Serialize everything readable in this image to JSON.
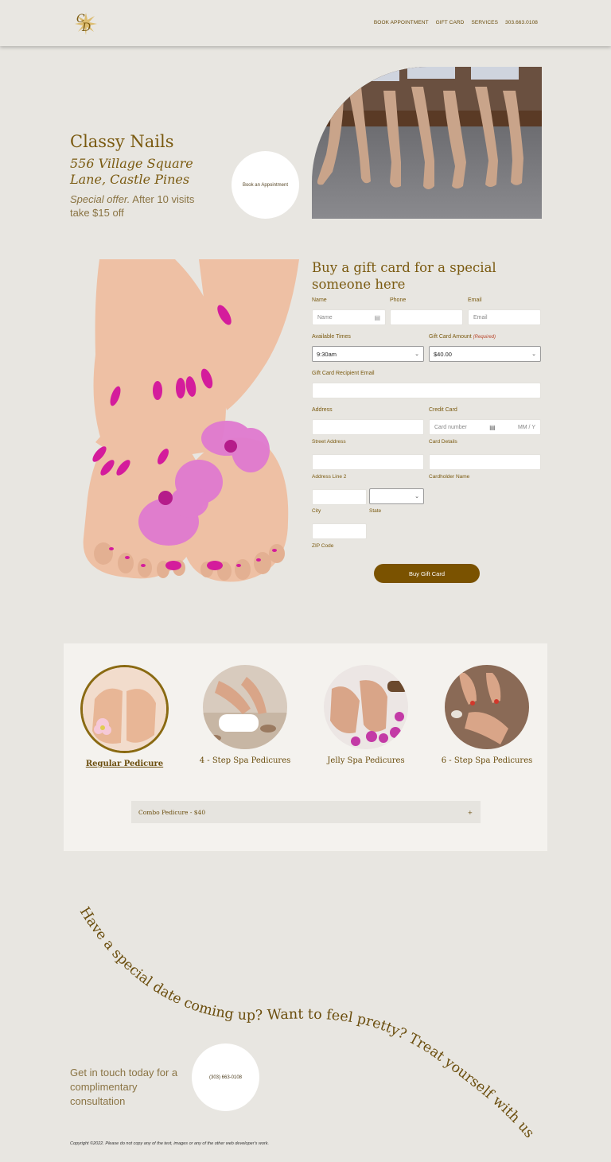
{
  "header": {
    "logo_text": "CD",
    "nav": [
      "BOOK APPOINTMENT",
      "GIFT CARD",
      "SERVICES",
      "303.663.0108"
    ]
  },
  "hero": {
    "title": "Classy Nails",
    "address": "556 Village Square Lane, Castle Pines",
    "offer_em": "Special offer.",
    "offer_rest": " After 10 visits take $15 off",
    "book_label": "Book an Appointment"
  },
  "gift": {
    "title": "Buy a gift card for a special someone here",
    "name_label": "Name",
    "phone_label": "Phone",
    "email_label": "Email",
    "name_placeholder": "Name",
    "email_placeholder": "Email",
    "times_label": "Available Times",
    "times_value": "9:30am",
    "amount_label": "Gift Card Amount",
    "amount_required": "(Required)",
    "amount_value": "$40.00",
    "recipient_label": "Gift Card Recipient Email",
    "address_label": "Address",
    "street_label": "Street Address",
    "line2_label": "Address Line 2",
    "city_label": "City",
    "state_label": "State",
    "zip_label": "ZIP Code",
    "cc_label": "Credit Card",
    "card_number_placeholder": "Card number",
    "card_exp_placeholder": "MM / Y",
    "card_details_label": "Card Details",
    "cardholder_label": "Cardholder Name",
    "buy_label": "Buy Gift Card"
  },
  "services": {
    "items": [
      {
        "label": "Regular Pedicure"
      },
      {
        "label": "4 - Step Spa Pedicures"
      },
      {
        "label": "Jelly Spa Pedicures"
      },
      {
        "label": "6 - Step Spa Pedicures"
      }
    ],
    "accordion_label": "Combo Pedicure - $40",
    "accordion_icon": "+"
  },
  "tagline": "Have a special date coming up? Want to feel pretty? Treat yourself with us at Classy Nails",
  "contact": {
    "text": "Get in touch today for a complimentary consultation",
    "phone": "(303) 663-0108"
  },
  "footer": {
    "copyright": "Copyright ©2022. Please do not copy any of the text, images or any of the other web developer's work."
  },
  "colors": {
    "background": "#e8e6e1",
    "accent": "#7a5a10",
    "button": "#7a5200",
    "panel": "#f4f2ee"
  }
}
